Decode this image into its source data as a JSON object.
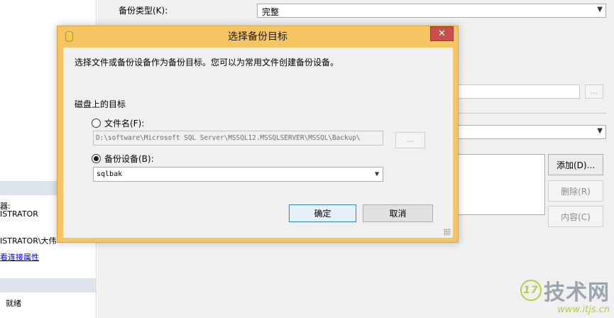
{
  "background": {
    "left_pane": {
      "fragment_1": "器:",
      "fragment_2": "ISTRATOR",
      "fragment_3": "ISTRATOR\\大伟",
      "link": "看连接属性",
      "status": "就绪"
    },
    "main": {
      "backup_type_label": "备份类型(K):",
      "backup_type_value": "完整",
      "add_button": "添加(D)...",
      "remove_button": "删除(R)",
      "contents_button": "内容(C)",
      "ellipsis": "..."
    }
  },
  "dialog": {
    "title": "选择备份目标",
    "close_glyph": "✕",
    "description": "选择文件或备份设备作为备份目标。您可以为常用文件创建备份设备。",
    "group_title": "磁盘上的目标",
    "file_option": {
      "label": "文件名(F):",
      "selected": false,
      "path": "D:\\software\\Microsoft SQL Server\\MSSQL12.MSSQLSERVER\\MSSQL\\Backup\\",
      "browse_label": "..."
    },
    "device_option": {
      "label": "备份设备(B):",
      "selected": true,
      "value": "sqlbak"
    },
    "ok_button": "确定",
    "cancel_button": "取消"
  },
  "watermark": {
    "circle": "17",
    "logo_text": "技术网",
    "url": "www.itjs.cn"
  },
  "colors": {
    "dialog_frame": "#f5c463",
    "close_button": "#c7504b",
    "link": "#0000cc"
  }
}
